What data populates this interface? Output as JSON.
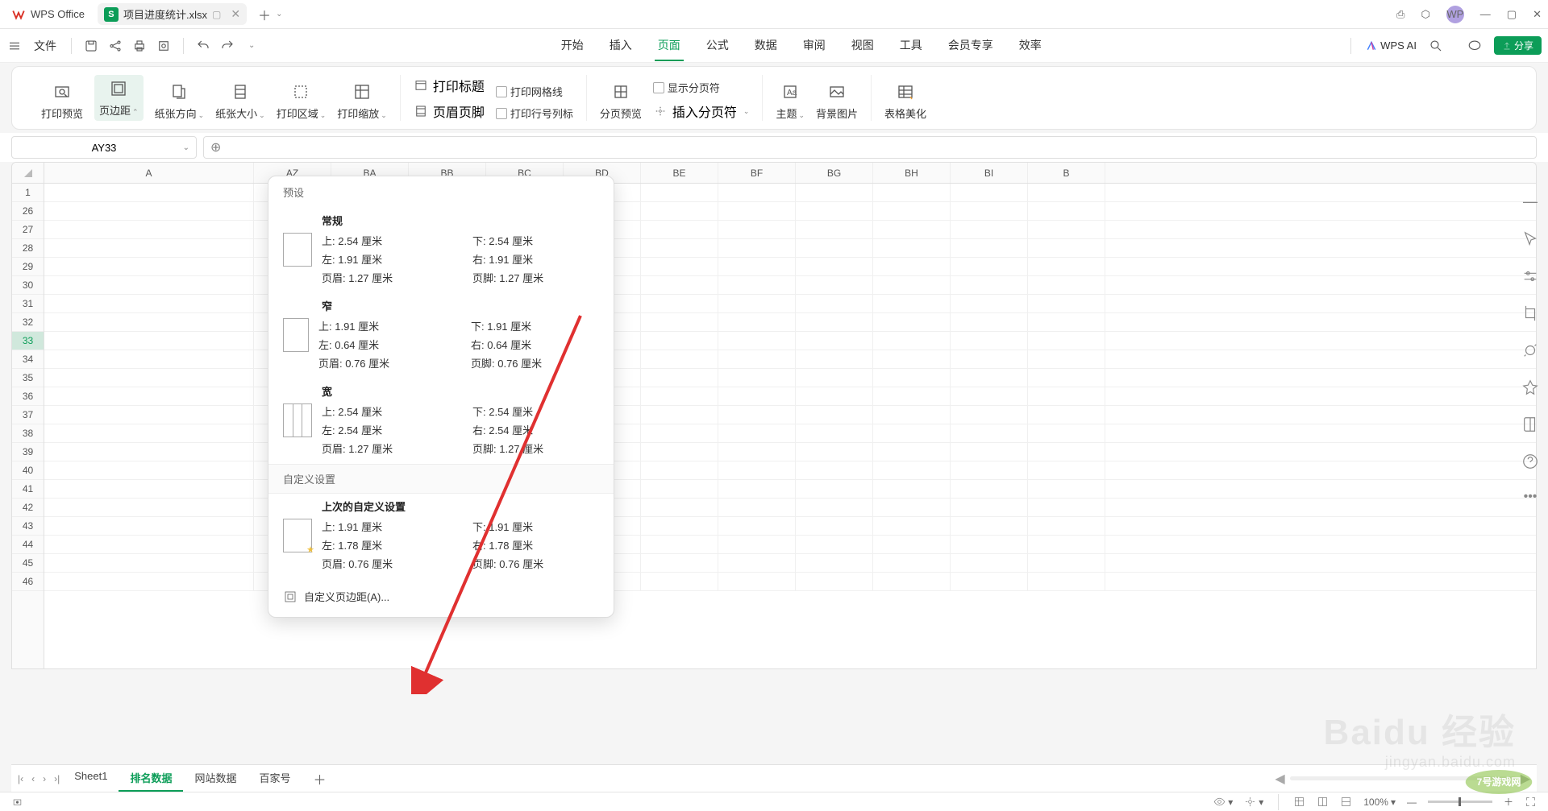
{
  "app": {
    "name": "WPS Office",
    "file_name": "项目进度统计.xlsx",
    "avatar": "WP"
  },
  "file_menu": "文件",
  "menus": [
    "开始",
    "插入",
    "页面",
    "公式",
    "数据",
    "审阅",
    "视图",
    "工具",
    "会员专享",
    "效率"
  ],
  "active_menu": 2,
  "ai_label": "WPS AI",
  "share_label": "分享",
  "ribbon": {
    "print_preview": "打印预览",
    "margins": "页边距",
    "orientation": "纸张方向",
    "size": "纸张大小",
    "area": "打印区域",
    "scale": "打印缩放",
    "titles": "打印标题",
    "gridlines": "打印网格线",
    "hf": "页眉页脚",
    "rowcol": "打印行号列标",
    "break_preview": "分页预览",
    "show_breaks": "显示分页符",
    "insert_break": "插入分页符",
    "theme": "主题",
    "bg": "背景图片",
    "beautify": "表格美化"
  },
  "namebox": "AY33",
  "columns": [
    "A",
    "AZ",
    "BA",
    "BB",
    "BC",
    "BD",
    "BE",
    "BF",
    "BG",
    "BH",
    "BI",
    "B"
  ],
  "rows": [
    1,
    26,
    27,
    28,
    29,
    30,
    31,
    32,
    33,
    34,
    35,
    36,
    37,
    38,
    39,
    40,
    41,
    42,
    43,
    44,
    45,
    46
  ],
  "selected_row": 33,
  "dropdown": {
    "presets_header": "预设",
    "normal": {
      "title": "常规",
      "vals": [
        "上:  2.54 厘米",
        "下:  2.54 厘米",
        "左:  1.91 厘米",
        "右:  1.91 厘米",
        "页眉:  1.27 厘米",
        "页脚:  1.27 厘米"
      ]
    },
    "narrow": {
      "title": "窄",
      "vals": [
        "上:  1.91 厘米",
        "下:  1.91 厘米",
        "左:  0.64 厘米",
        "右:  0.64 厘米",
        "页眉:  0.76 厘米",
        "页脚:  0.76 厘米"
      ]
    },
    "wide": {
      "title": "宽",
      "vals": [
        "上:  2.54 厘米",
        "下:  2.54 厘米",
        "左:  2.54 厘米",
        "右:  2.54 厘米",
        "页眉:  1.27 厘米",
        "页脚:  1.27 厘米"
      ]
    },
    "custom_header": "自定义设置",
    "last_custom": {
      "title": "上次的自定义设置",
      "vals": [
        "上:  1.91 厘米",
        "下:  1.91 厘米",
        "左:  1.78 厘米",
        "右:  1.78 厘米",
        "页眉:  0.76 厘米",
        "页脚:  0.76 厘米"
      ]
    },
    "custom_link": "自定义页边距(A)..."
  },
  "sheets": {
    "tabs": [
      "Sheet1",
      "排名数据",
      "网站数据",
      "百家号"
    ],
    "active": 1
  },
  "status": {
    "zoom": "100%"
  },
  "watermark": "Baidu 经验",
  "watermark_url": "jingyan.baidu.com"
}
